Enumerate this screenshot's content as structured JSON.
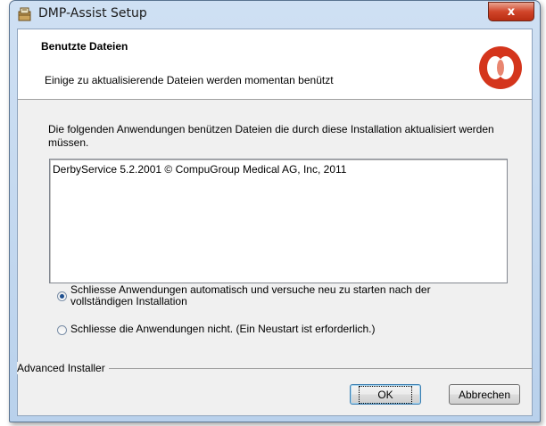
{
  "window": {
    "title": "DMP-Assist Setup",
    "close_glyph": "x"
  },
  "header": {
    "title": "Benutzte Dateien",
    "subtitle": "Einige zu aktualisierende Dateien werden momentan benützt"
  },
  "main": {
    "description": "Die folgenden Anwendungen benützen Dateien die durch diese Installation aktualisiert werden müssen.",
    "applications": [
      "DerbyService 5.2.2001 © CompuGroup Medical AG, Inc, 2011"
    ],
    "options": [
      {
        "label": "Schliesse Anwendungen automatisch und versuche neu zu starten nach der vollständigen Installation",
        "selected": true
      },
      {
        "label": "Schliesse die Anwendungen nicht. (Ein Neustart ist erforderlich.)",
        "selected": false
      }
    ]
  },
  "footer": {
    "brand": "Advanced Installer",
    "ok_label": "OK",
    "cancel_label": "Abbrechen"
  },
  "colors": {
    "logo_red": "#d4351c",
    "close_red": "#c8402a",
    "radio_dot": "#1e4f8f"
  }
}
